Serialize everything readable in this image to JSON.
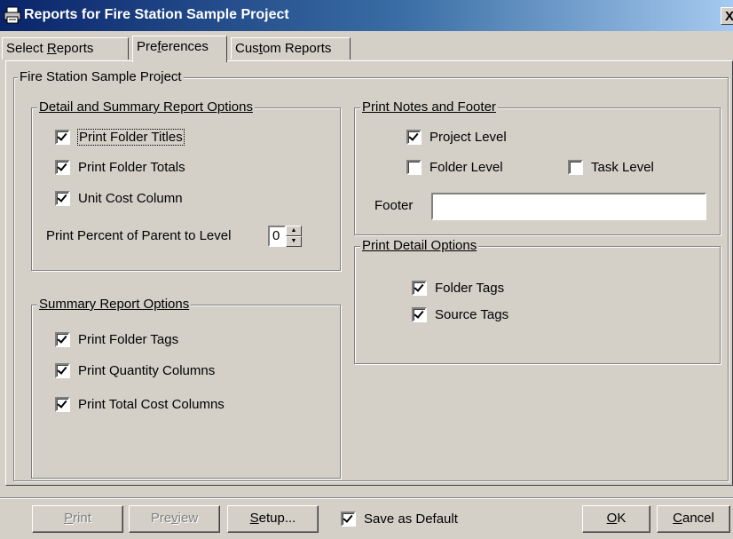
{
  "window": {
    "title": "Reports for Fire Station Sample Project",
    "close_glyph": "X",
    "icon": "printer-icon"
  },
  "tabs": [
    {
      "label_pre": "Select ",
      "label_ul": "R",
      "label_post": "eports",
      "active": false
    },
    {
      "label_pre": "Pre",
      "label_ul": "f",
      "label_post": "erences",
      "active": true
    },
    {
      "label_pre": "Cus",
      "label_ul": "t",
      "label_post": "om Reports",
      "active": false
    }
  ],
  "panel": {
    "title": "Fire Station Sample Project"
  },
  "detail_summary": {
    "legend": "Detail and Summary Report Options",
    "print_folder_titles": {
      "label": "Print Folder Titles",
      "checked": true
    },
    "print_folder_totals": {
      "label": "Print Folder Totals",
      "checked": true
    },
    "unit_cost_column": {
      "label": "Unit Cost Column",
      "checked": true
    },
    "percent_label": "Print Percent of Parent to Level",
    "percent_value": "0"
  },
  "summary": {
    "legend": "Summary Report Options",
    "print_folder_tags": {
      "label": "Print Folder Tags",
      "checked": true
    },
    "print_quantity_columns": {
      "label": "Print Quantity Columns",
      "checked": true
    },
    "print_total_cost_columns": {
      "label": "Print Total Cost Columns",
      "checked": true
    }
  },
  "notes_footer": {
    "legend": "Print Notes and Footer",
    "project_level": {
      "label": "Project Level",
      "checked": true
    },
    "folder_level": {
      "label": "Folder Level",
      "checked": false
    },
    "task_level": {
      "label": "Task Level",
      "checked": false
    },
    "footer_label": "Footer",
    "footer_value": ""
  },
  "detail_options": {
    "legend": "Print Detail Options",
    "folder_tags": {
      "label": "Folder Tags",
      "checked": true
    },
    "source_tags": {
      "label": "Source Tags",
      "checked": true
    }
  },
  "bottom": {
    "print": {
      "pre": "",
      "ul": "P",
      "post": "rint"
    },
    "preview": {
      "pre": "Pre",
      "ul": "v",
      "post": "iew"
    },
    "setup": {
      "pre": "",
      "ul": "S",
      "post": "etup..."
    },
    "save_default": {
      "label": "Save as Default",
      "checked": true
    },
    "ok": {
      "pre": "",
      "ul": "O",
      "post": "K"
    },
    "cancel": {
      "pre": "",
      "ul": "C",
      "post": "ancel"
    }
  }
}
